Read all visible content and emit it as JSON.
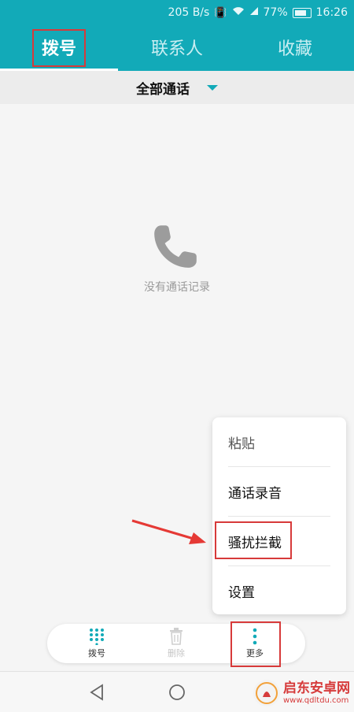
{
  "status_bar": {
    "speed": "205 B/s",
    "battery": "77%",
    "time": "16:26",
    "icons": [
      "vibrate-icon",
      "wifi-icon",
      "signal-icon",
      "battery-icon"
    ]
  },
  "tabs": [
    {
      "label": "拨号",
      "active": true
    },
    {
      "label": "联系人",
      "active": false
    },
    {
      "label": "收藏",
      "active": false
    }
  ],
  "filter": {
    "label": "全部通话",
    "icon": "dropdown-triangle-icon"
  },
  "empty_state": {
    "icon": "phone-icon",
    "text": "没有通话记录"
  },
  "menu": {
    "items": [
      {
        "label": "粘贴",
        "enabled": false
      },
      {
        "label": "通话录音",
        "enabled": true
      },
      {
        "label": "骚扰拦截",
        "enabled": true
      },
      {
        "label": "设置",
        "enabled": true
      }
    ]
  },
  "toolbar": {
    "dial_label": "拨号",
    "delete_label": "删除",
    "more_label": "更多"
  },
  "watermark": {
    "title": "启东安卓网",
    "url": "www.qdltdu.com"
  },
  "colors": {
    "accent": "#12aab8",
    "highlight": "#d73a3a"
  }
}
